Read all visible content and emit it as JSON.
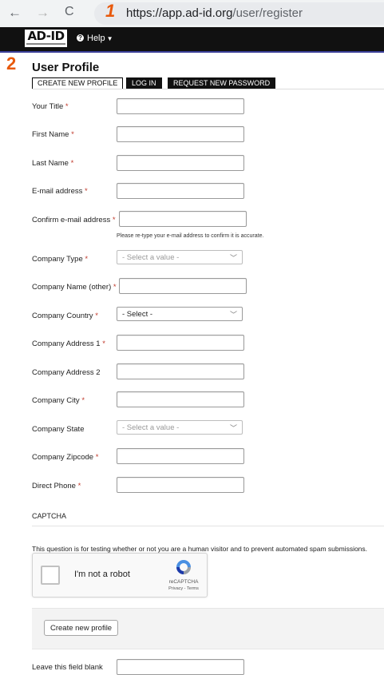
{
  "browser": {
    "back_icon": "←",
    "forward_icon": "→",
    "reload_icon": "C",
    "url_host": "https://app.ad-id.org",
    "url_path": "/user/register",
    "annotation_1": "1",
    "annotation_2": "2"
  },
  "header": {
    "logo": "AD-ID",
    "help_label": "Help"
  },
  "page": {
    "title": "User Profile",
    "tabs": [
      "CREATE NEW PROFILE",
      "LOG IN",
      "REQUEST NEW PASSWORD"
    ]
  },
  "form": {
    "fields": [
      {
        "label": "Your Title",
        "required": "*"
      },
      {
        "label": "First Name",
        "required": "*"
      },
      {
        "label": "Last Name",
        "required": "*"
      },
      {
        "label": "E-mail address",
        "required": "*"
      },
      {
        "label": "Confirm e-mail address",
        "required": "*"
      },
      {
        "label": "Company Type",
        "required": "*",
        "select_value": "- Select a value -"
      },
      {
        "label": "Company Name (other)",
        "required": "*"
      },
      {
        "label": "Company Country",
        "required": "*",
        "select_value": "- Select -"
      },
      {
        "label": "Company Address 1",
        "required": "*"
      },
      {
        "label": "Company Address 2"
      },
      {
        "label": "Company City",
        "required": "*"
      },
      {
        "label": "Company State",
        "select_value": "- Select a value -"
      },
      {
        "label": "Company Zipcode",
        "required": "*"
      },
      {
        "label": "Direct Phone",
        "required": "*"
      }
    ],
    "confirm_hint": "Please re-type your e-mail address to confirm it is accurate.",
    "honeypot_label": "Leave this field blank"
  },
  "captcha": {
    "title": "CAPTCHA",
    "description": "This question is for testing whether or not you are a human visitor and to prevent automated spam submissions.",
    "checkbox_label": "I'm not a robot",
    "brand": "reCAPTCHA",
    "terms": "Privacy - Terms"
  },
  "actions": {
    "submit_label": "Create new profile"
  }
}
